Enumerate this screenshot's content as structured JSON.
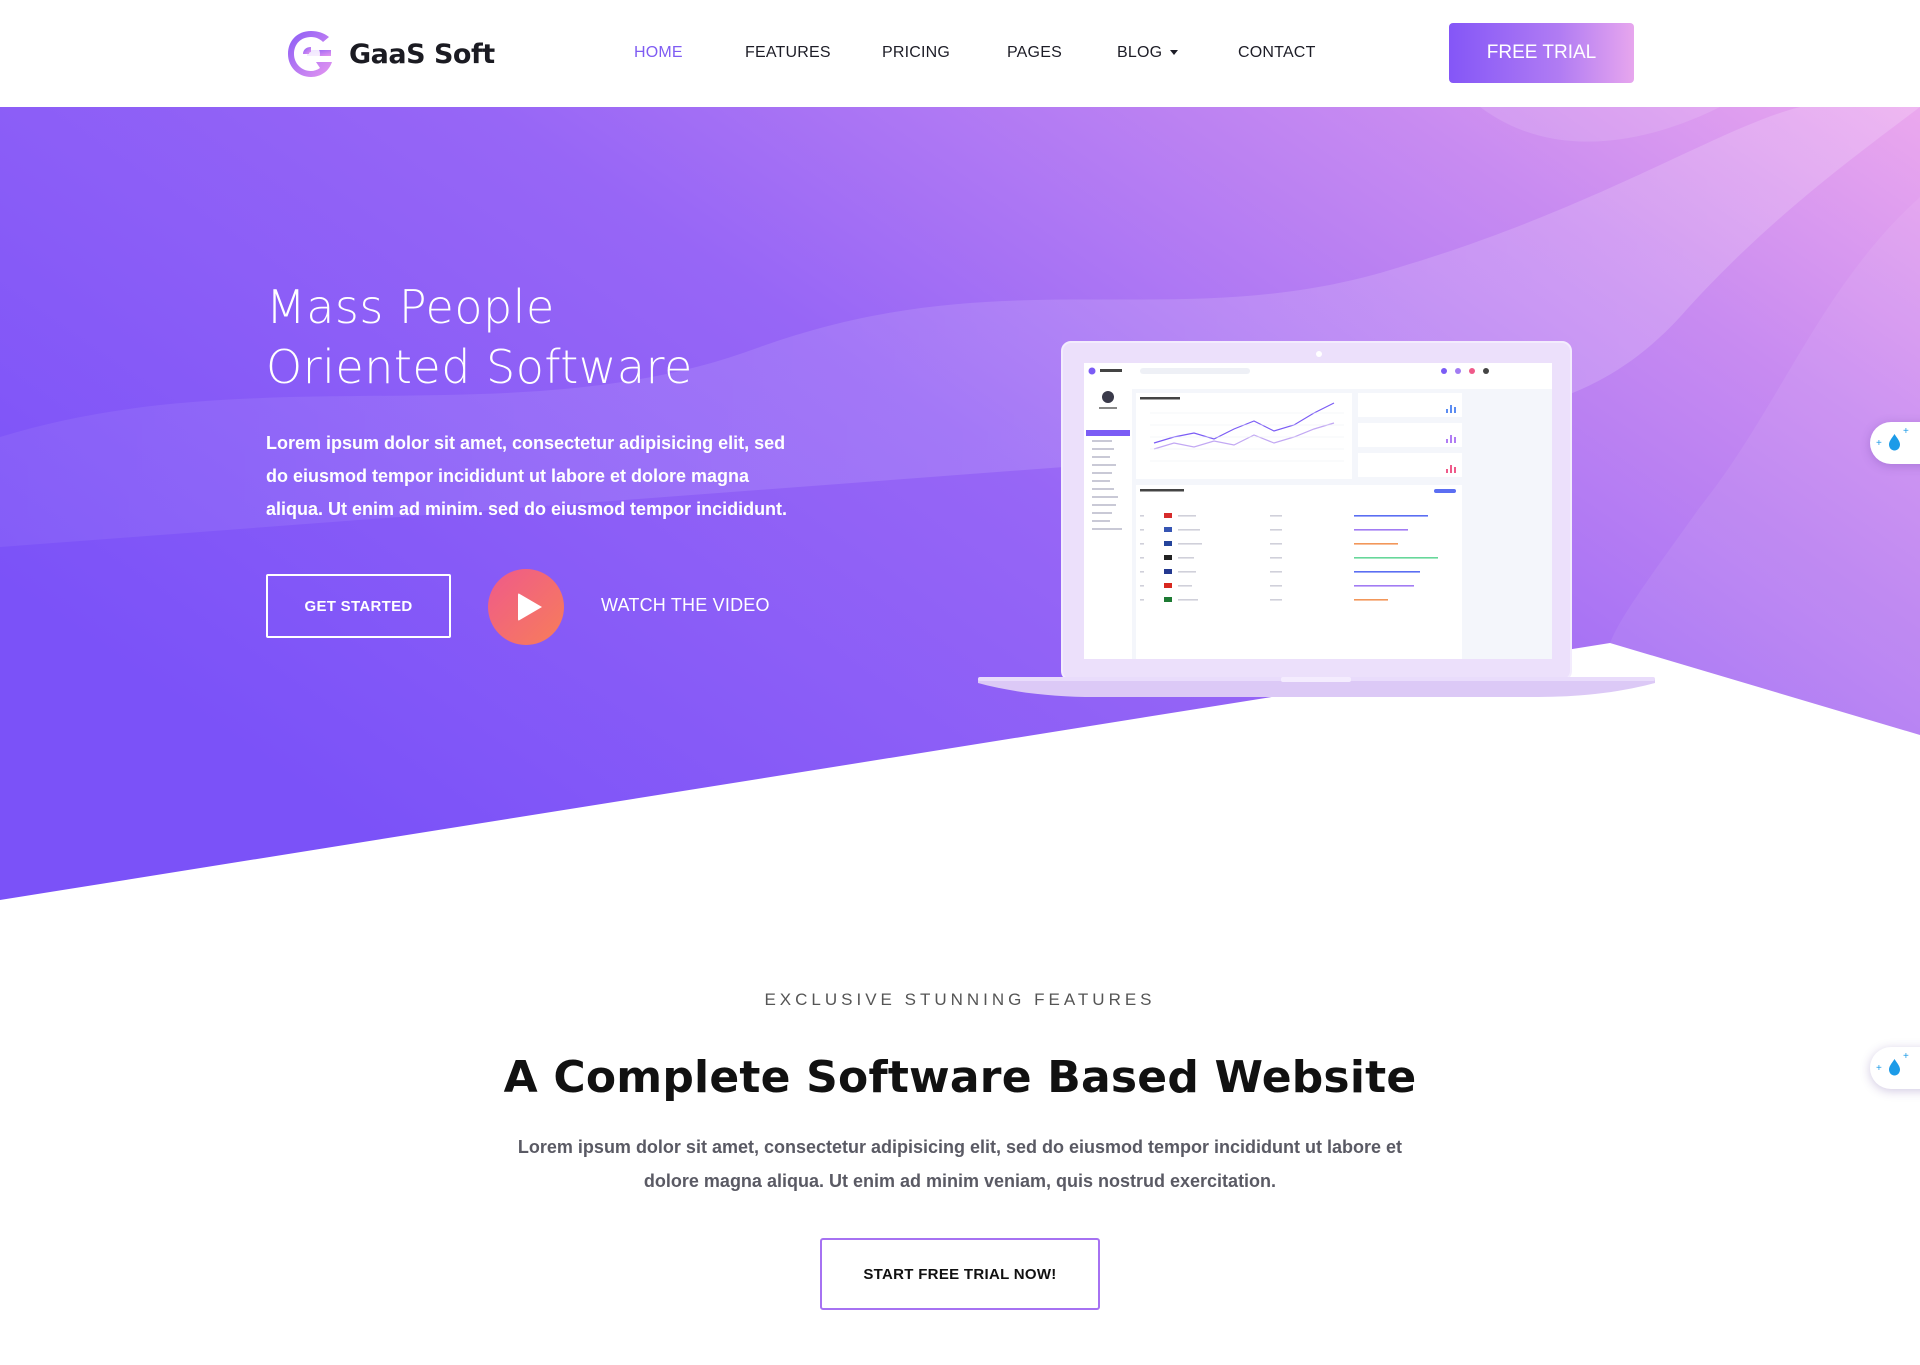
{
  "brand": {
    "name": "GaaS Soft"
  },
  "nav": {
    "items": [
      {
        "label": "HOME",
        "active": true
      },
      {
        "label": "FEATURES",
        "active": false
      },
      {
        "label": "PRICING",
        "active": false
      },
      {
        "label": "PAGES",
        "active": false
      },
      {
        "label": "BLOG",
        "active": false,
        "dropdown": true
      },
      {
        "label": "CONTACT",
        "active": false
      }
    ],
    "cta": "FREE TRIAL"
  },
  "hero": {
    "title_line1": "Mass People",
    "title_line2": "Oriented Software",
    "description": "Lorem ipsum dolor sit amet, consectetur adipisicing elit, sed do eiusmod tempor incididunt ut labore et dolore magna aliqua. Ut enim ad minim. sed do eiusmod tempor incididunt.",
    "primary_button": "GET STARTED",
    "video_link": "WATCH THE VIDEO"
  },
  "features": {
    "tagline": "EXCLUSIVE STUNNING FEATURES",
    "title": "A Complete Software Based Website",
    "description": "Lorem ipsum dolor sit amet, consectetur adipisicing elit, sed do eiusmod tempor incididunt ut labore et dolore magna aliqua. Ut enim ad minim veniam, quis nostrud exercitation.",
    "cta": "START FREE TRIAL NOW!"
  },
  "colors": {
    "accent": "#7f5cf3",
    "hero_start": "#7d55f8",
    "hero_end": "#e6a4f0",
    "play_start": "#ef5a8a",
    "play_end": "#f77d5a"
  },
  "icons": {
    "side_widget": "water-drop-sparkle-icon",
    "play": "play-icon",
    "dropdown": "chevron-down-icon"
  }
}
